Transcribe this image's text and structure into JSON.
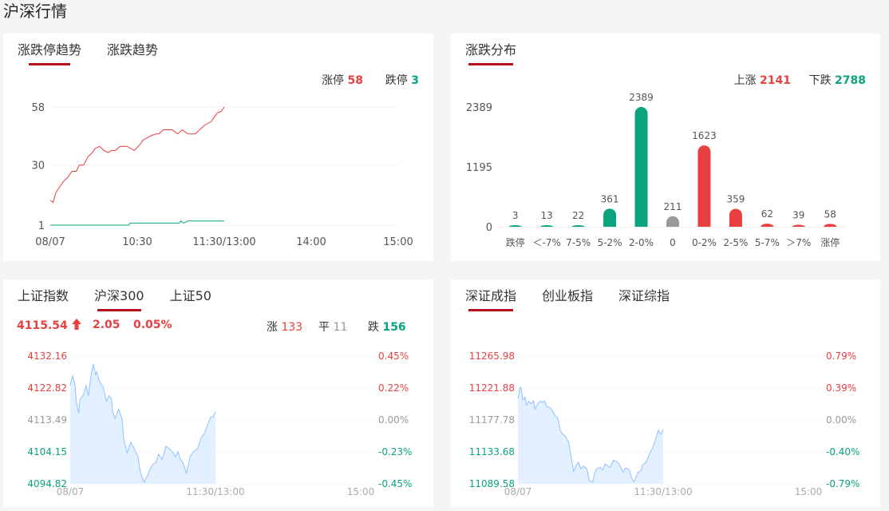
{
  "page_title": "沪深行情",
  "colors": {
    "up": "#e84040",
    "down": "#0aa37f",
    "flat": "#999999",
    "accent": "#b5121b",
    "area_line": "#8ec2ff",
    "area_fill": "#e3f0ff"
  },
  "limit_panel": {
    "tabs": [
      {
        "label": "涨跌停趋势",
        "active": true
      },
      {
        "label": "涨跌趋势",
        "active": false
      }
    ],
    "limit_up_label": "涨停",
    "limit_up": "58",
    "limit_down_label": "跌停",
    "limit_down": "3"
  },
  "dist_panel": {
    "tabs": [
      {
        "label": "涨跌分布",
        "active": true
      }
    ],
    "up_label": "上涨",
    "up": "2141",
    "down_label": "下跌",
    "down": "2788"
  },
  "index_panel_left": {
    "tabs": [
      {
        "label": "上证指数",
        "active": false
      },
      {
        "label": "沪深300",
        "active": true
      },
      {
        "label": "上证50",
        "active": false
      }
    ],
    "price": "4115.54",
    "arrow_icon": "arrow-up-icon",
    "change": "2.05",
    "change_pct": "0.05%",
    "up_label": "涨",
    "up": "133",
    "flat_label": "平",
    "flat": "11",
    "down_label": "跌",
    "down": "156"
  },
  "index_panel_right": {
    "tabs": [
      {
        "label": "深证成指",
        "active": true
      },
      {
        "label": "创业板指",
        "active": false
      },
      {
        "label": "深证综指",
        "active": false
      }
    ]
  },
  "chart_data": [
    {
      "type": "line",
      "yticks": [
        1,
        30,
        58
      ],
      "ylim": [
        1,
        58
      ],
      "xticks": [
        "08/07",
        "10:30",
        "11:30/13:00",
        "14:00",
        "15:00"
      ],
      "grid": true,
      "series": [
        {
          "name": "涨停",
          "color": "#e84040",
          "points": [
            [
              "09:30",
              13
            ],
            [
              "09:32",
              12
            ],
            [
              "09:34",
              17
            ],
            [
              "09:37",
              20
            ],
            [
              "09:39",
              22
            ],
            [
              "09:42",
              24
            ],
            [
              "09:45",
              27
            ],
            [
              "09:48",
              27
            ],
            [
              "09:50",
              30
            ],
            [
              "09:53",
              30
            ],
            [
              "09:56",
              34
            ],
            [
              "09:59",
              36
            ],
            [
              "10:01",
              38
            ],
            [
              "10:04",
              39
            ],
            [
              "10:07",
              37
            ],
            [
              "10:10",
              36
            ],
            [
              "10:12",
              37
            ],
            [
              "10:15",
              37
            ],
            [
              "10:18",
              39
            ],
            [
              "10:23",
              39
            ],
            [
              "10:28",
              37
            ],
            [
              "10:32",
              40
            ],
            [
              "10:34",
              42
            ],
            [
              "10:39",
              44
            ],
            [
              "10:43",
              45
            ],
            [
              "10:45",
              45
            ],
            [
              "10:48",
              47
            ],
            [
              "10:54",
              47
            ],
            [
              "10:58",
              45
            ],
            [
              "11:01",
              47
            ],
            [
              "11:05",
              45
            ],
            [
              "11:10",
              45
            ],
            [
              "11:16",
              49
            ],
            [
              "11:21",
              51
            ],
            [
              "11:25",
              55
            ],
            [
              "11:28",
              56
            ],
            [
              "11:30",
              58
            ]
          ]
        },
        {
          "name": "跌停",
          "color": "#0aa37f",
          "points": [
            [
              "09:30",
              1
            ],
            [
              "10:24",
              1
            ],
            [
              "10:25",
              2
            ],
            [
              "10:59",
              2
            ],
            [
              "11:00",
              3
            ],
            [
              "11:02",
              2
            ],
            [
              "11:05",
              3
            ],
            [
              "11:30",
              3
            ]
          ]
        }
      ]
    },
    {
      "type": "bar",
      "yticks": [
        0,
        1195,
        2389
      ],
      "ylim": [
        0,
        2389
      ],
      "categories": [
        "跌停",
        "<-7%",
        "7-5%",
        "5-2%",
        "2-0%",
        "0",
        "0-2%",
        "2-5%",
        "5-7%",
        ">7%",
        "涨停"
      ],
      "category_labels": [
        "跌停",
        "＜-7%",
        "7-5%",
        "5-2%",
        "2-0%",
        "0",
        "0-2%",
        "2-5%",
        "5-7%",
        "＞7%",
        "涨停"
      ],
      "values": [
        3,
        13,
        22,
        361,
        2389,
        211,
        1623,
        359,
        62,
        39,
        58
      ],
      "colors": [
        "#0aa37f",
        "#0aa37f",
        "#0aa37f",
        "#0aa37f",
        "#0aa37f",
        "#999999",
        "#e84040",
        "#e84040",
        "#e84040",
        "#e84040",
        "#e84040"
      ]
    },
    {
      "type": "area",
      "name": "沪深300",
      "yticks": [
        4132.16,
        4122.82,
        4113.49,
        4104.15,
        4094.82
      ],
      "pct_ticks": [
        "0.45%",
        "0.22%",
        "0.00%",
        "-0.23%",
        "-0.45%"
      ],
      "ylim": [
        4094.82,
        4132.16
      ],
      "xticks": [
        "08/07",
        "11:30/13:00",
        "15:00"
      ],
      "points": [
        [
          "09:30",
          4123.64
        ],
        [
          "09:32",
          4126.35
        ],
        [
          "09:34",
          4123.64
        ],
        [
          "09:35",
          4118.99
        ],
        [
          "09:37",
          4115.5
        ],
        [
          "09:38",
          4119.38
        ],
        [
          "09:41",
          4120.93
        ],
        [
          "09:43",
          4123.64
        ],
        [
          "09:45",
          4120.54
        ],
        [
          "09:47",
          4125.96
        ],
        [
          "09:49",
          4129.84
        ],
        [
          "09:51",
          4126.74
        ],
        [
          "09:52",
          4127.51
        ],
        [
          "09:54",
          4124.8
        ],
        [
          "09:57",
          4123.25
        ],
        [
          "10:00",
          4118.99
        ],
        [
          "10:02",
          4120.54
        ],
        [
          "10:04",
          4119.76
        ],
        [
          "10:05",
          4115.89
        ],
        [
          "10:07",
          4113.95
        ],
        [
          "10:10",
          4116.67
        ],
        [
          "10:13",
          4113.57
        ],
        [
          "10:14",
          4108.14
        ],
        [
          "10:17",
          4103.88
        ],
        [
          "10:20",
          4106.98
        ],
        [
          "10:23",
          4105.04
        ],
        [
          "10:26",
          4102.72
        ],
        [
          "10:28",
          4098.07
        ],
        [
          "10:31",
          4095.36
        ],
        [
          "10:34",
          4097.3
        ],
        [
          "10:36",
          4099.23
        ],
        [
          "10:38",
          4100.4
        ],
        [
          "10:41",
          4101.17
        ],
        [
          "10:43",
          4103.5
        ],
        [
          "10:46",
          4101.95
        ],
        [
          "10:49",
          4105.82
        ],
        [
          "10:52",
          4105.04
        ],
        [
          "10:55",
          4103.88
        ],
        [
          "10:57",
          4102.72
        ],
        [
          "10:59",
          4104.27
        ],
        [
          "11:01",
          4101.95
        ],
        [
          "11:03",
          4101.17
        ],
        [
          "11:06",
          4097.92
        ],
        [
          "11:09",
          4102.72
        ],
        [
          "11:12",
          4104.27
        ],
        [
          "11:15",
          4105.04
        ],
        [
          "11:18",
          4108.14
        ],
        [
          "11:21",
          4109.69
        ],
        [
          "11:26",
          4114.34
        ],
        [
          "11:28",
          4114.34
        ],
        [
          "11:30",
          4115.89
        ]
      ]
    },
    {
      "type": "area",
      "name": "深证成指",
      "yticks": [
        11265.98,
        11221.88,
        11177.78,
        11133.68,
        11089.58
      ],
      "pct_ticks": [
        "0.79%",
        "0.39%",
        "0.00%",
        "-0.40%",
        "-0.79%"
      ],
      "ylim": [
        11089.58,
        11265.98
      ],
      "xticks": [
        "08/07",
        "11:30/13:00",
        "15:00"
      ],
      "points": [
        [
          "09:30",
          11207.42
        ],
        [
          "09:32",
          11223.89
        ],
        [
          "09:33",
          11218.4
        ],
        [
          "09:34",
          11205.59
        ],
        [
          "09:36",
          11209.25
        ],
        [
          "09:37",
          11198.27
        ],
        [
          "09:39",
          11203.76
        ],
        [
          "09:41",
          11200.1
        ],
        [
          "09:43",
          11204.49
        ],
        [
          "09:44",
          11192.78
        ],
        [
          "09:47",
          11201.93
        ],
        [
          "09:49",
          11203.76
        ],
        [
          "09:50",
          11201.93
        ],
        [
          "09:52",
          11203.76
        ],
        [
          "09:54",
          11196.44
        ],
        [
          "09:57",
          11194.61
        ],
        [
          "10:00",
          11185.46
        ],
        [
          "10:03",
          11179.97
        ],
        [
          "10:05",
          11163.5
        ],
        [
          "10:07",
          11158.01
        ],
        [
          "10:09",
          11156.18
        ],
        [
          "10:12",
          11147.03
        ],
        [
          "10:14",
          11126.9
        ],
        [
          "10:16",
          11106.77
        ],
        [
          "10:18",
          11114.09
        ],
        [
          "10:20",
          11119.58
        ],
        [
          "10:22",
          11110.43
        ],
        [
          "10:24",
          11114.09
        ],
        [
          "10:27",
          11110.43
        ],
        [
          "10:29",
          11093.96
        ],
        [
          "10:32",
          11092.13
        ],
        [
          "10:33",
          11103.11
        ],
        [
          "10:35",
          11110.43
        ],
        [
          "10:38",
          11112.26
        ],
        [
          "10:40",
          11108.6
        ],
        [
          "10:42",
          11117.02
        ],
        [
          "10:44",
          11114.82
        ],
        [
          "10:46",
          11112.26
        ],
        [
          "10:49",
          11122.14
        ],
        [
          "10:52",
          11119.58
        ],
        [
          "10:54",
          11115.92
        ],
        [
          "10:57",
          11105.67
        ],
        [
          "10:59",
          11111.53
        ],
        [
          "11:02",
          11109.33
        ],
        [
          "11:04",
          11097.62
        ],
        [
          "11:06",
          11092.13
        ],
        [
          "11:09",
          11104.94
        ],
        [
          "11:12",
          11108.6
        ],
        [
          "11:13",
          11115.92
        ],
        [
          "11:16",
          11119.58
        ],
        [
          "11:19",
          11132.39
        ],
        [
          "11:21",
          11137.88
        ],
        [
          "11:24",
          11152.52
        ],
        [
          "11:26",
          11163.5
        ],
        [
          "11:28",
          11158.01
        ],
        [
          "11:30",
          11164.23
        ]
      ]
    }
  ]
}
